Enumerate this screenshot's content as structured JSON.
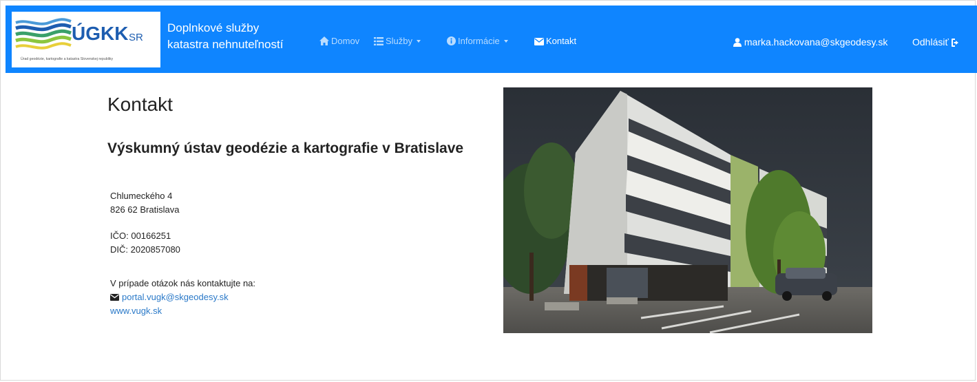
{
  "header": {
    "logo": {
      "main_text": "ÚGKK",
      "sr_text": "SR",
      "subtitle": "Úrad geodézie, kartografie a katastra Slovenskej republiky"
    },
    "brand_line1": "Doplnkové služby",
    "brand_line2": "katastra nehnuteľností",
    "nav": {
      "home": "Domov",
      "services": "Služby",
      "info": "Informácie",
      "contact": "Kontakt"
    },
    "user_email": "marka.hackovana@skgeodesy.sk",
    "logout": "Odhlásiť",
    "colors": {
      "navbar": "#0f85ff",
      "nav_inactive": "#b9dcff",
      "nav_active": "#ffffff"
    },
    "icons": [
      "home-icon",
      "list-icon",
      "info-icon",
      "envelope-icon",
      "user-icon",
      "logout-icon"
    ]
  },
  "content": {
    "title": "Kontakt",
    "organization": "Výskumný ústav geodézie a kartografie v Bratislave",
    "address_line1": "Chlumeckého 4",
    "address_line2": "826 62 Bratislava",
    "ico": "IČO: 00166251",
    "dic": "DIČ: 2020857080",
    "contact_prompt": "V prípade otázok nás kontaktujte na:",
    "email": "portal.vugk@skgeodesy.sk",
    "website": "www.vugk.sk",
    "link_color": "#2a79c8"
  }
}
